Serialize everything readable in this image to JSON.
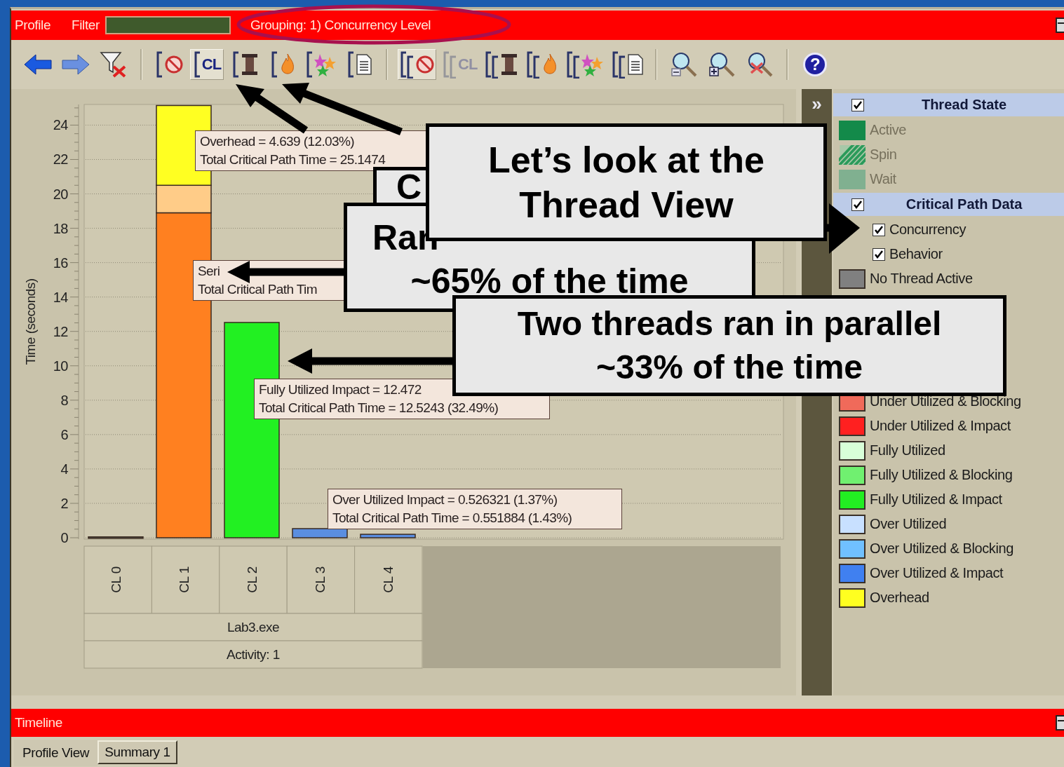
{
  "profile_bar": {
    "title": "Profile",
    "filter_label": "Filter",
    "grouping": "Grouping: 1) Concurrency Level"
  },
  "toolbar": {
    "groups": [
      {
        "buttons": [
          {
            "kind": "back",
            "selected": false,
            "disabled": false
          },
          {
            "kind": "forward",
            "selected": false,
            "disabled": false
          },
          {
            "kind": "filter-clear",
            "selected": false,
            "disabled": false
          }
        ]
      },
      {
        "buttons": [
          {
            "kind": "no-sign",
            "nested": false,
            "selected": false,
            "disabled": false
          },
          {
            "kind": "text",
            "text": "CL",
            "nested": false,
            "selected": true,
            "disabled": false
          },
          {
            "kind": "spool",
            "nested": false,
            "selected": false,
            "disabled": false
          },
          {
            "kind": "flame",
            "nested": false,
            "selected": false,
            "disabled": false
          },
          {
            "kind": "figures",
            "nested": false,
            "selected": false,
            "disabled": false
          },
          {
            "kind": "document",
            "nested": false,
            "selected": false,
            "disabled": false
          }
        ]
      },
      {
        "buttons": [
          {
            "kind": "no-sign",
            "nested": true,
            "selected": true,
            "disabled": false
          },
          {
            "kind": "text",
            "text": "CL",
            "nested": true,
            "selected": false,
            "disabled": true
          },
          {
            "kind": "spool",
            "nested": true,
            "selected": false,
            "disabled": false
          },
          {
            "kind": "flame",
            "nested": true,
            "selected": false,
            "disabled": false
          },
          {
            "kind": "figures",
            "nested": true,
            "selected": false,
            "disabled": false
          },
          {
            "kind": "document",
            "nested": true,
            "selected": false,
            "disabled": false
          }
        ]
      },
      {
        "buttons": [
          {
            "kind": "zoom-out",
            "selected": false,
            "disabled": false
          },
          {
            "kind": "zoom-in",
            "selected": false,
            "disabled": false
          },
          {
            "kind": "zoom-clear",
            "selected": false,
            "disabled": false
          }
        ]
      },
      {
        "buttons": [
          {
            "kind": "help",
            "text": "?",
            "selected": false,
            "disabled": false
          }
        ]
      }
    ]
  },
  "chart": {
    "chart_data": {
      "type": "bar",
      "stacked": true,
      "grid": true,
      "ylabel": "Time (seconds)",
      "categories": [
        "CL 0",
        "CL 1",
        "CL 2",
        "CL 3",
        "CL 4"
      ],
      "ylim": [
        0,
        25.2
      ],
      "yticks": [
        0,
        2,
        4,
        6,
        8,
        10,
        12,
        14,
        16,
        18,
        20,
        22,
        24
      ],
      "series": [
        {
          "color": "#505050",
          "values": [
            0.05,
            0,
            0,
            0,
            0
          ]
        },
        {
          "color": "#ff8020",
          "values": [
            0,
            18.9,
            0,
            0,
            0
          ]
        },
        {
          "color": "#ffcc88",
          "values": [
            0,
            1.6,
            0,
            0,
            0
          ]
        },
        {
          "color": "#22f022",
          "values": [
            0,
            0,
            12.52,
            0,
            0
          ]
        },
        {
          "color": "#5a8ee0",
          "values": [
            0,
            0,
            0,
            0.53,
            0.2
          ]
        },
        {
          "color": "#ffff22",
          "values": [
            0,
            4.64,
            0,
            0,
            0
          ]
        }
      ]
    },
    "tooltips": [
      {
        "lines": [
          "Overhead = 4.639 (12.03%)",
          "Total Critical Path Time = 25.1474"
        ]
      },
      {
        "lines": [
          "Seri",
          "Total Critical Path Tim"
        ]
      },
      {
        "lines": [
          "Fully Utilized Impact = 12.472",
          "Total Critical Path Time = 12.5243 (32.49%)"
        ]
      },
      {
        "lines": [
          "Over Utilized Impact = 0.526321 (1.37%)",
          "Total Critical Path Time = 0.551884 (1.43%)"
        ]
      }
    ],
    "process": "Lab3.exe",
    "activity": "Activity: 1"
  },
  "legend": {
    "collapse_button": "»",
    "top_items": [
      {
        "kind": "header",
        "label": "Thread State",
        "checked": true
      },
      {
        "kind": "swatch",
        "label": "Active",
        "color": "#138a4a",
        "disabled": true
      },
      {
        "kind": "hatch",
        "label": "Spin",
        "color": "#2a9a5a",
        "disabled": true
      },
      {
        "kind": "swatch",
        "label": "Wait",
        "color": "#80b090",
        "disabled": true
      },
      {
        "kind": "header",
        "label": "Critical Path Data",
        "checked": true
      },
      {
        "kind": "check",
        "label": "Concurrency",
        "checked": true
      },
      {
        "kind": "check",
        "label": "Behavior",
        "checked": true
      },
      {
        "kind": "swatch",
        "label": "No Thread Active",
        "color": "#808080",
        "disabled": false
      }
    ],
    "bottom_items": [
      {
        "label": "Under Utilized & Blocking",
        "color": "#f06a5a"
      },
      {
        "label": "Under Utilized & Impact",
        "color": "#ff2020"
      },
      {
        "label": "Fully Utilized",
        "color": "#d8ffd8"
      },
      {
        "label": "Fully Utilized & Blocking",
        "color": "#70f070"
      },
      {
        "label": "Fully Utilized & Impact",
        "color": "#22ee22"
      },
      {
        "label": "Over Utilized",
        "color": "#c8e0ff"
      },
      {
        "label": "Over Utilized & Blocking",
        "color": "#70c0ff"
      },
      {
        "label": "Over Utilized & Impact",
        "color": "#4080f0"
      },
      {
        "label": "Overhead",
        "color": "#ffff20"
      }
    ]
  },
  "timeline": {
    "title": "Timeline"
  },
  "tabs": [
    {
      "label": "Profile View",
      "selected": true
    },
    {
      "label": "Summary 1",
      "selected": false
    }
  ],
  "callouts": [
    {
      "lines": [
        "C"
      ]
    },
    {
      "lines": [
        "Let’s look at the",
        "Thread View"
      ]
    },
    {
      "lines": [
        "Ran",
        "~65% of the time"
      ]
    },
    {
      "lines": [
        "Two threads ran in parallel",
        "~33% of the time"
      ]
    }
  ]
}
